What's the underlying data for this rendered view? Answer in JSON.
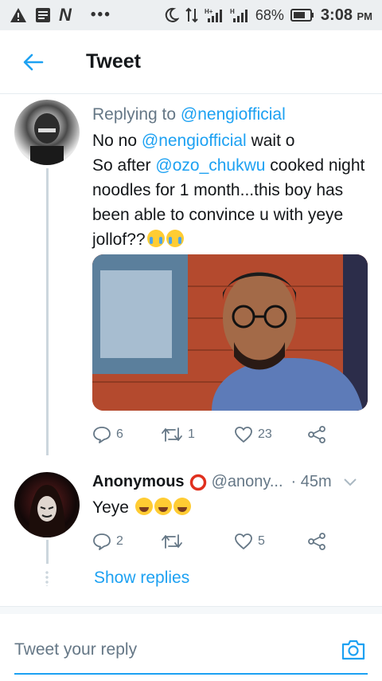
{
  "status_bar": {
    "battery_percent": "68%",
    "time": "3:08",
    "ampm": "PM",
    "signal_1": "H+",
    "signal_2": "H"
  },
  "header": {
    "title": "Tweet"
  },
  "tweet1": {
    "replying_prefix": "Replying to ",
    "replying_handle": "@nengiofficial",
    "line1_a": "No no ",
    "line1_mention": "@nengiofficial",
    "line1_b": " wait o",
    "line2_a": "So after ",
    "line2_mention": "@ozo_chukwu",
    "line2_b": " cooked night noodles for 1 month...this boy has been able to convince u with yeye jollof??",
    "replies": "6",
    "retweets": "1",
    "likes": "23"
  },
  "tweet2": {
    "name": "Anonymous",
    "handle": "@anony...",
    "time": "· 45m",
    "text": "Yeye",
    "replies": "2",
    "retweets": "",
    "likes": "5"
  },
  "show_replies": "Show replies",
  "reply_bar": {
    "placeholder": "Tweet your reply"
  },
  "colors": {
    "accent": "#1da1f2",
    "muted": "#657786",
    "text": "#14171a"
  }
}
